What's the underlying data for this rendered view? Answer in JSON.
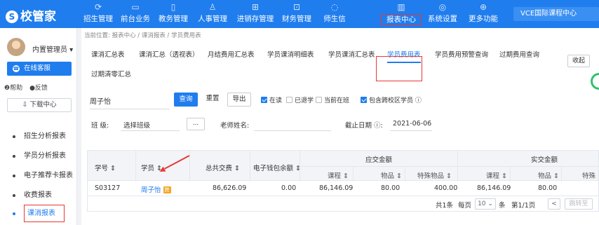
{
  "logo": {
    "mark": "S",
    "text": "校管家"
  },
  "nav": [
    {
      "label": "招生管理",
      "icon": "⟳"
    },
    {
      "label": "前台业务",
      "icon": "▭"
    },
    {
      "label": "教务管理",
      "icon": "▯"
    },
    {
      "label": "人事管理",
      "icon": "♙"
    },
    {
      "label": "进销存管理",
      "icon": "⊞"
    },
    {
      "label": "财务管理",
      "icon": "⊡"
    },
    {
      "label": "师生信",
      "icon": "◌"
    },
    {
      "label": "报表中心",
      "icon": "▥"
    },
    {
      "label": "系统设置",
      "icon": "◎"
    },
    {
      "label": "更多功能",
      "icon": "⊕"
    }
  ],
  "campus": "VCE国际课程中心",
  "sidebar": {
    "admin_name": "内置管理员 ▾",
    "kefu": "在线客服",
    "kefu_icon": "☎",
    "help": "❷帮助",
    "feedback": "●反馈",
    "download": "⇩ 下载中心",
    "items": [
      {
        "label": "招生分析报表"
      },
      {
        "label": "学员分析报表"
      },
      {
        "label": "电子推荐卡报表"
      },
      {
        "label": "收费报表"
      },
      {
        "label": "课消报表"
      }
    ]
  },
  "breadcrumb": "当前位置: 报表中心 / 课消报表 / 学员费用表",
  "tabs": [
    "课消汇总表",
    "课消汇总（透视表）",
    "月结费用汇总表",
    "学员课消明细表",
    "学员课消汇总表",
    "学员费用表",
    "学员费用预警查询",
    "过期费用查询",
    "过期清零汇总"
  ],
  "collapse": "收起",
  "filter": {
    "student": "周子怡",
    "query": "查询",
    "reset": "重置",
    "export": "导出",
    "chk_enrolled": "在读",
    "chk_withdrawn": "已退学",
    "chk_current": "当前在班",
    "chk_cross": "包含跨校区学员 ⓘ",
    "class_label": "班 级:",
    "class_placeholder": "选择班级",
    "dots": "...",
    "teacher_label": "老师姓名:",
    "deadline_label": "截止日期 ⓘ:",
    "deadline": "2021-06-06"
  },
  "table": {
    "headers": {
      "student_no": "学号 ⇕",
      "student": "学员 ⇕",
      "total": "总共交费 ⇕",
      "wallet": "电子钱包余额 ⇕",
      "due": "应交金额",
      "actual": "实交金额",
      "course": "课程 ⇕",
      "goods": "物品 ⇕",
      "special": "特殊物品 ⇕",
      "course2": "课程 ⇕",
      "goods2": "物品 ⇕",
      "special2": "特殊"
    },
    "row": {
      "student_no": "S03127",
      "student": "周子怡",
      "tag": "跨",
      "total": "86,626.09",
      "wallet": "0.00",
      "due_course": "86,146.09",
      "due_goods": "80.00",
      "due_special": "400.00",
      "act_course": "86,146.09",
      "act_goods": "80.00"
    }
  },
  "pager": {
    "total": "共1条",
    "per_page_label": "每页",
    "per_page": "10 ⌄",
    "unit": "条",
    "page": "第1/1页",
    "prev": "<",
    "goto": "跳转至"
  }
}
